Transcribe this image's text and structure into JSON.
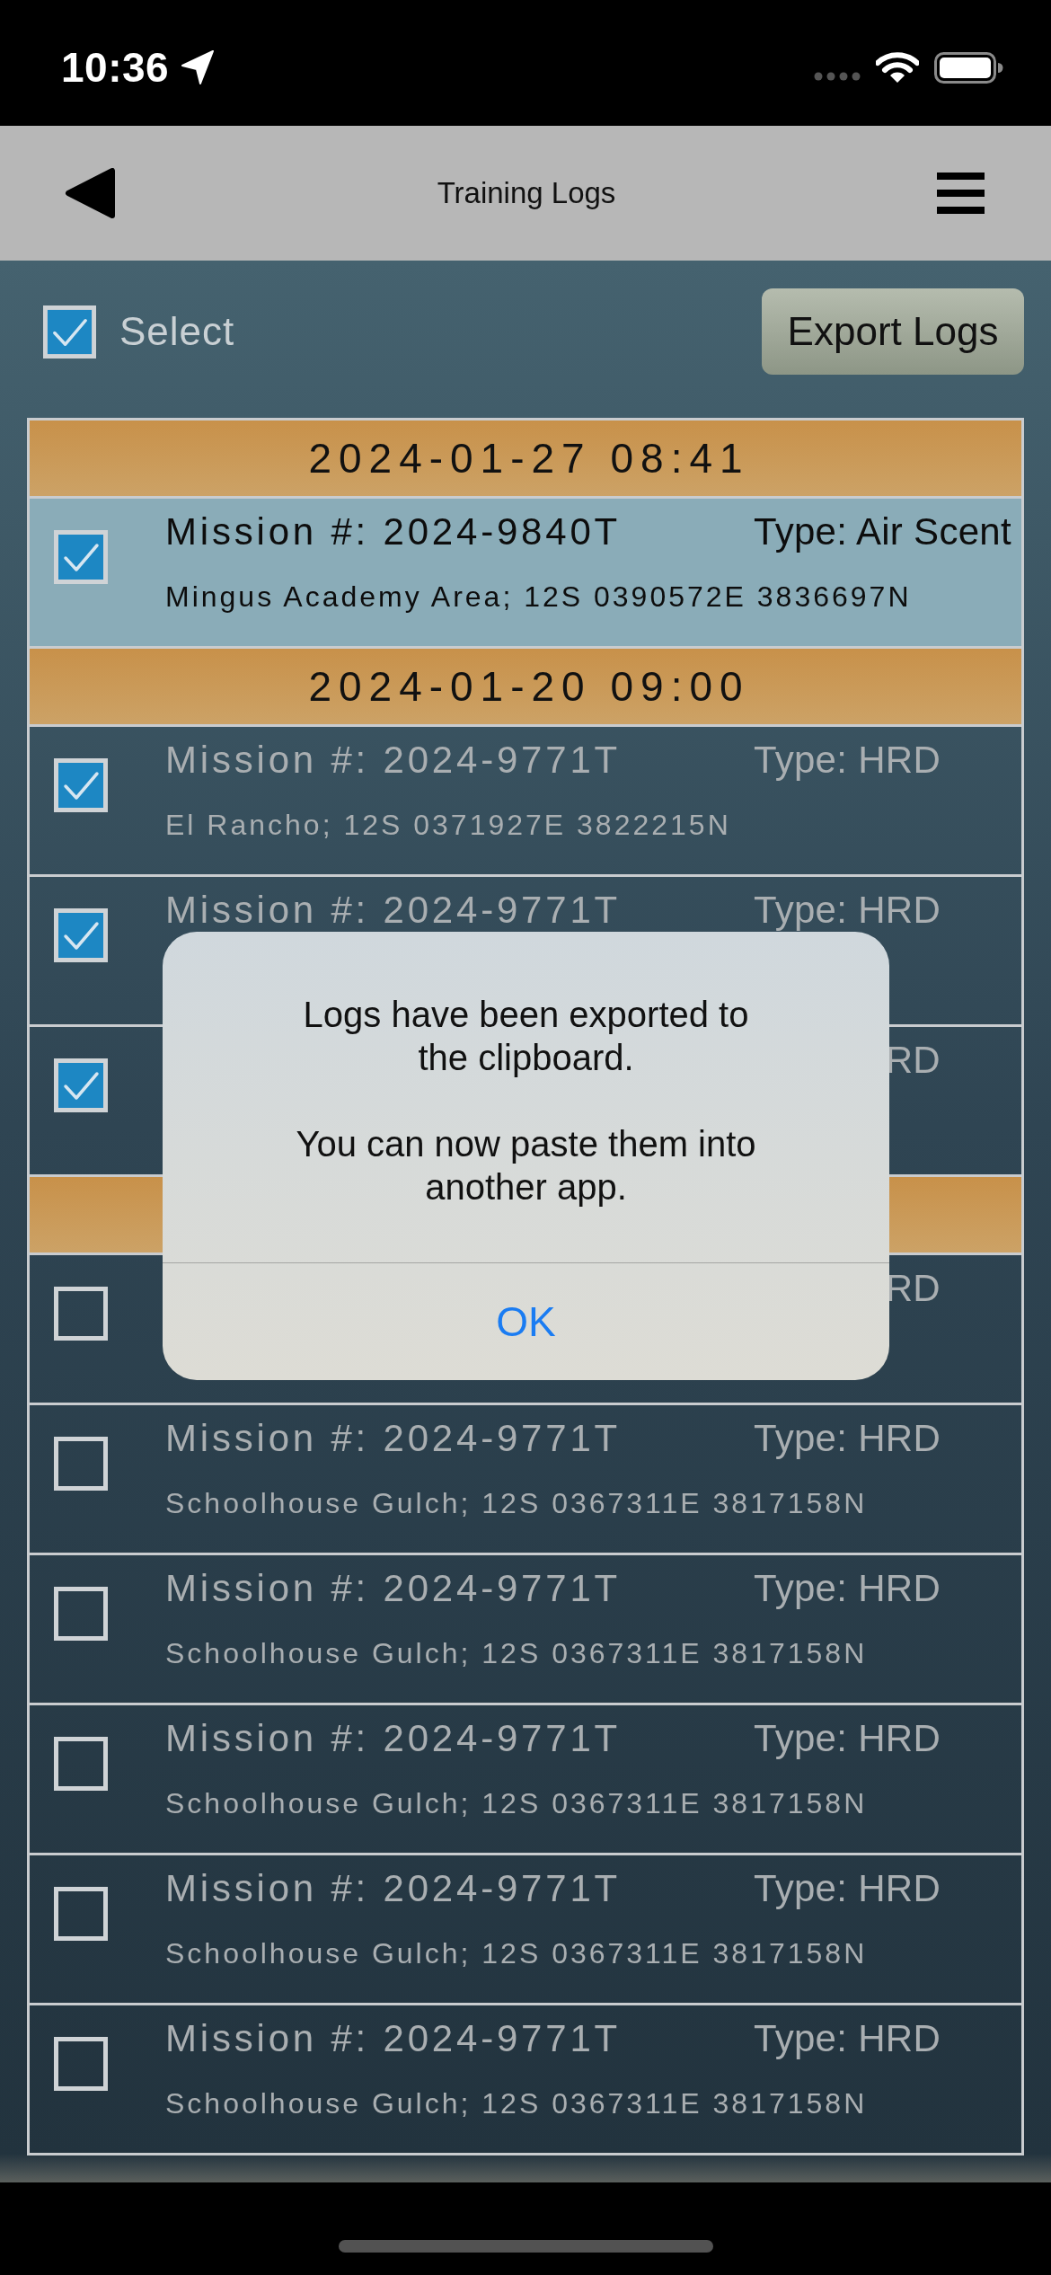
{
  "status_bar": {
    "time": "10:36"
  },
  "header": {
    "title": "Training Logs"
  },
  "toolbar": {
    "select": {
      "label": "Select",
      "checked": true
    },
    "export_button": "Export Logs"
  },
  "groups": [
    {
      "date": "2024-01-27 08:41",
      "logs": [
        {
          "kind": "entry",
          "checked": true,
          "selected": true,
          "mission": "Mission #: 2024-9840T",
          "type": "Type: Air Scent",
          "location": "Mingus Academy Area; 12S 0390572E 3836697N"
        }
      ]
    },
    {
      "date": "2024-01-20 09:00",
      "logs": [
        {
          "kind": "entry",
          "checked": true,
          "selected": false,
          "mission": "Mission #: 2024-9771T",
          "type": "Type: HRD",
          "location": "El Rancho; 12S 0371927E 3822215N"
        },
        {
          "kind": "entry",
          "checked": true,
          "selected": false,
          "mission": "Mission #: 2024-9771T",
          "type": "Type: HRD"
        },
        {
          "kind": "covered",
          "checked": true,
          "selected": false,
          "type": "RD"
        }
      ]
    },
    {
      "logs": [
        {
          "kind": "covered",
          "checked": false,
          "selected": false,
          "type": "RD"
        },
        {
          "kind": "entry",
          "checked": false,
          "selected": false,
          "mission": "Mission #: 2024-9771T",
          "type": "Type: HRD",
          "location": "Schoolhouse Gulch; 12S 0367311E 3817158N"
        },
        {
          "kind": "entry",
          "checked": false,
          "selected": false,
          "mission": "Mission #: 2024-9771T",
          "type": "Type: HRD",
          "location": "Schoolhouse Gulch; 12S 0367311E 3817158N"
        },
        {
          "kind": "entry",
          "checked": false,
          "selected": false,
          "mission": "Mission #: 2024-9771T",
          "type": "Type: HRD",
          "location": "Schoolhouse Gulch; 12S 0367311E 3817158N"
        },
        {
          "kind": "entry",
          "checked": false,
          "selected": false,
          "mission": "Mission #: 2024-9771T",
          "type": "Type: HRD",
          "location": "Schoolhouse Gulch; 12S 0367311E 3817158N"
        },
        {
          "kind": "entry",
          "checked": false,
          "selected": false,
          "mission": "Mission #: 2024-9771T",
          "type": "Type: HRD",
          "location": "Schoolhouse Gulch; 12S 0367311E 3817158N"
        }
      ]
    }
  ],
  "alert": {
    "message": "Logs have been exported to the clipboard.\n\nYou can now paste them into another app.",
    "button": "OK"
  }
}
